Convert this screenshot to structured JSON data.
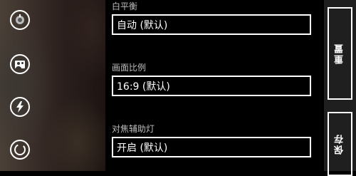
{
  "camera": {
    "buttons": [
      {
        "icon": "lens-toggle-icon"
      },
      {
        "icon": "scene-mode-icon"
      },
      {
        "icon": "flash-icon"
      },
      {
        "icon": "capture-icon"
      }
    ]
  },
  "settings": [
    {
      "label": "白平衡",
      "value": "自动 (默认)"
    },
    {
      "label": "画面比例",
      "value": "16:9 (默认)"
    },
    {
      "label": "对焦辅助灯",
      "value": "开启 (默认)"
    }
  ],
  "appbar": {
    "reset_label": "重置",
    "save_label": "保存"
  },
  "colors": {
    "background": "#000000",
    "appbar": "#1f1f1f",
    "border": "#ffffff",
    "label": "#bdbdbd"
  }
}
